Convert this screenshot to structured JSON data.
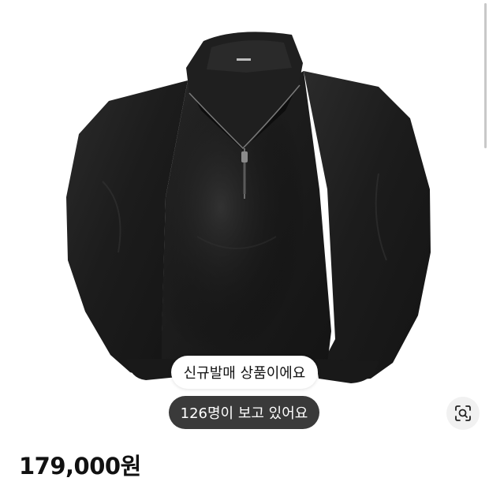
{
  "badges": {
    "new_release": "신규발매 상품이에요",
    "viewers": "126명이 보고 있어요"
  },
  "price": "179,000원",
  "icons": {
    "image_search": "image-search-icon"
  },
  "product_image": {
    "subject": "black leather half-zip stand-collar pullover jacket"
  },
  "colors": {
    "viewers_pill": "#3a3a3a",
    "jacket": "#1e1e1e"
  }
}
